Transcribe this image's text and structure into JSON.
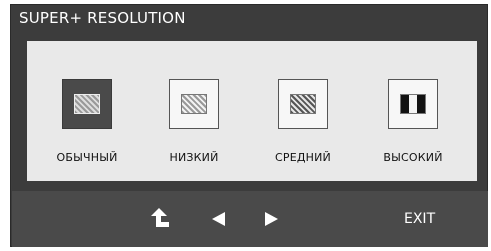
{
  "osd": {
    "title": "SUPER+ RESOLUTION"
  },
  "options": [
    {
      "label": "ОБЫЧНЫЙ",
      "icon": "normal-quality-icon",
      "selected": true
    },
    {
      "label": "НИЗКИЙ",
      "icon": "low-quality-icon",
      "selected": false
    },
    {
      "label": "СРЕДНИЙ",
      "icon": "medium-quality-icon",
      "selected": false
    },
    {
      "label": "ВЫСОКИЙ",
      "icon": "high-quality-icon",
      "selected": false
    }
  ],
  "nav": {
    "exit_label": "EXIT",
    "icons": [
      "return-icon",
      "left-arrow-icon",
      "right-arrow-icon"
    ]
  },
  "colors": {
    "osd_bg": "#3c3c3c",
    "panel_bg": "#e9e9e9",
    "nav_bg": "#4a4a4a",
    "selected_box": "#4a4a4a"
  }
}
